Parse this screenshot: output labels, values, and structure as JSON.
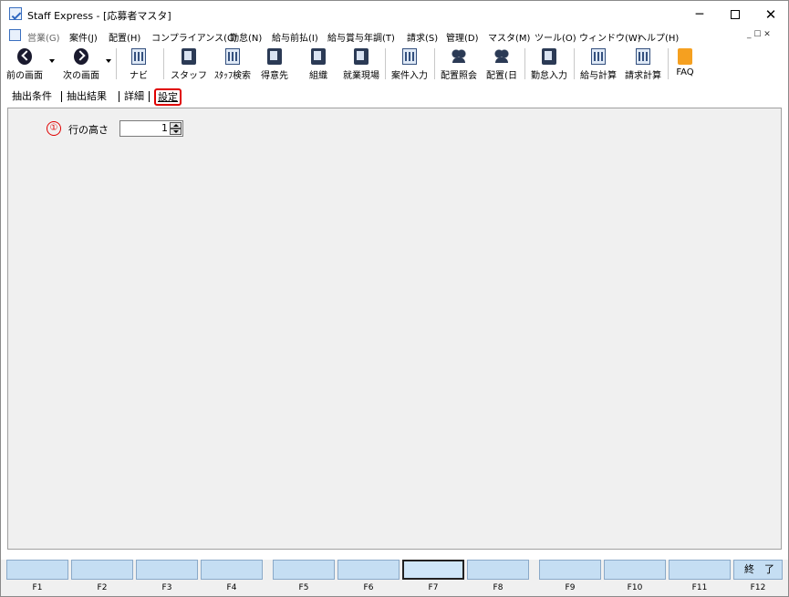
{
  "window": {
    "title": "Staff Express - [応募者マスタ]"
  },
  "window_controls": {
    "minimize": "─",
    "maximize": "□",
    "close": "✕"
  },
  "menu": {
    "items": [
      "営業(G)",
      "案件(J)",
      "配置(H)",
      "コンプライアンス(C)",
      "勤怠(N)",
      "給与前払(I)",
      "給与賞与年調(T)",
      "請求(S)",
      "管理(D)",
      "マスタ(M)",
      "ツール(O)",
      "ウィンドウ(W)",
      "ヘルプ(H)"
    ],
    "mdi_controls": "_ ☐ ✕"
  },
  "toolbar": {
    "buttons": [
      {
        "label": "前の画面",
        "icon": "back-arrow-icon"
      },
      {
        "label": "次の画面",
        "icon": "forward-arrow-icon"
      },
      {
        "label": "ナビ",
        "icon": "navi-icon"
      },
      {
        "label": "スタッフ",
        "icon": "staff-icon"
      },
      {
        "label": "ｽﾀｯﾌ検索",
        "icon": "staff-search-icon"
      },
      {
        "label": "得意先",
        "icon": "customer-icon"
      },
      {
        "label": "組織",
        "icon": "organization-icon"
      },
      {
        "label": "就業現場",
        "icon": "worksite-icon"
      },
      {
        "label": "案件入力",
        "icon": "case-entry-icon"
      },
      {
        "label": "配置照会",
        "icon": "placement-inquiry-icon"
      },
      {
        "label": "配置(日",
        "icon": "placement-daily-icon"
      },
      {
        "label": "勤怠入力",
        "icon": "attendance-entry-icon"
      },
      {
        "label": "給与計算",
        "icon": "payroll-icon"
      },
      {
        "label": "請求計算",
        "icon": "billing-icon"
      },
      {
        "label": "FAQ",
        "icon": "faq-icon"
      }
    ]
  },
  "tabs": [
    "抽出条件",
    "抽出結果",
    "詳細",
    "設定"
  ],
  "active_tab": "設定",
  "settings": {
    "marker": "①",
    "row_height_label": "行の高さ",
    "row_height_value": "1"
  },
  "function_keys": [
    {
      "label": "F1",
      "text": ""
    },
    {
      "label": "F2",
      "text": ""
    },
    {
      "label": "F3",
      "text": ""
    },
    {
      "label": "F4",
      "text": ""
    },
    {
      "label": "F5",
      "text": ""
    },
    {
      "label": "F6",
      "text": ""
    },
    {
      "label": "F7",
      "text": ""
    },
    {
      "label": "F8",
      "text": ""
    },
    {
      "label": "F9",
      "text": ""
    },
    {
      "label": "F10",
      "text": ""
    },
    {
      "label": "F11",
      "text": ""
    },
    {
      "label": "F12",
      "text": "終　了"
    }
  ],
  "colors": {
    "highlight": "#e00000",
    "fkey_fill": "#c5def3",
    "content_bg": "#f0f0f0"
  }
}
